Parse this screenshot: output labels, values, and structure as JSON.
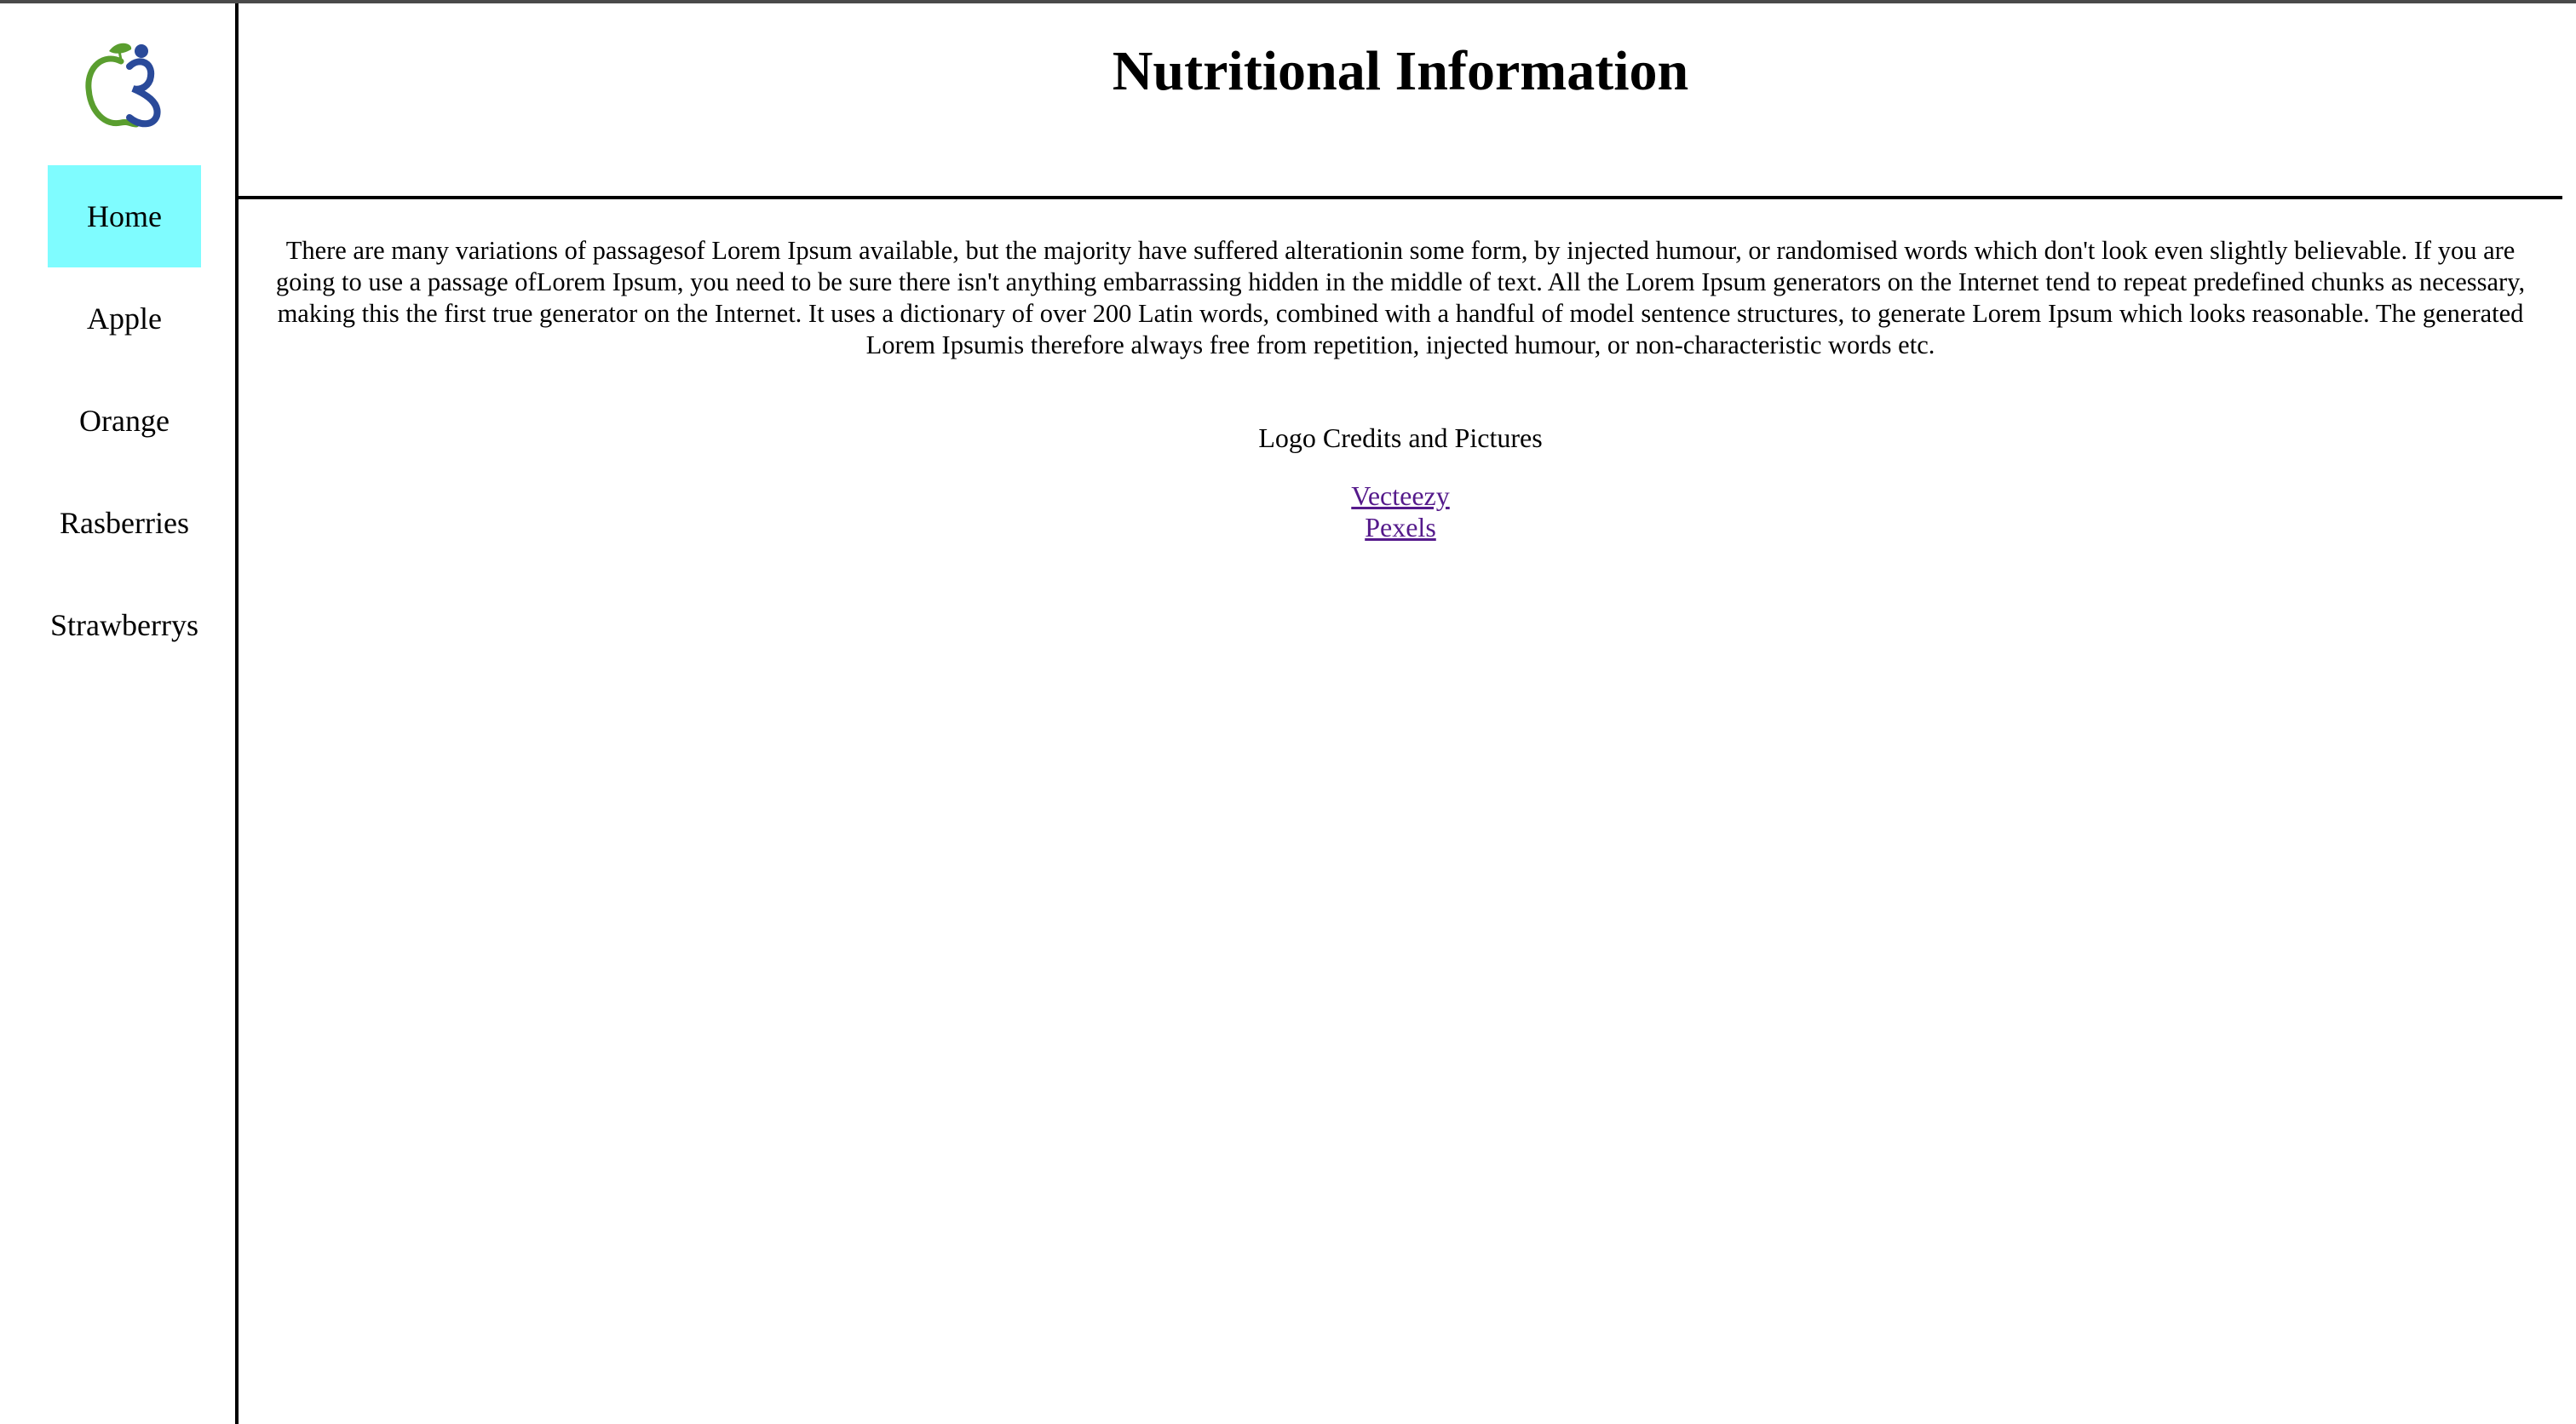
{
  "sidebar": {
    "logo_icon": "apple-person-logo-icon",
    "items": [
      {
        "label": "Home",
        "active": true
      },
      {
        "label": "Apple",
        "active": false
      },
      {
        "label": "Orange",
        "active": false
      },
      {
        "label": "Rasberries",
        "active": false
      },
      {
        "label": "Strawberrys",
        "active": false
      }
    ],
    "active_color": "#7ffcff"
  },
  "main": {
    "title": "Nutritional Information",
    "paragraph": "There are many variations of passagesof Lorem Ipsum available, but the majority have suffered alterationin some form, by injected humour, or randomised words which don't look even slightly believable. If you are going to use a passage ofLorem Ipsum, you need to be sure there isn't anything embarrassing hidden in the middle of text. All the Lorem Ipsum generators on the Internet tend to repeat predefined chunks as necessary, making this the first true generator on the Internet. It uses a dictionary of over 200 Latin words, combined with a handful of model sentence structures, to generate Lorem Ipsum which looks reasonable. The generated Lorem Ipsumis therefore always free from repetition, injected humour, or non-characteristic words etc.",
    "credits_heading": "Logo Credits and Pictures",
    "links": [
      {
        "label": "Vecteezy"
      },
      {
        "label": "Pexels"
      }
    ],
    "link_color": "#551a8b"
  }
}
